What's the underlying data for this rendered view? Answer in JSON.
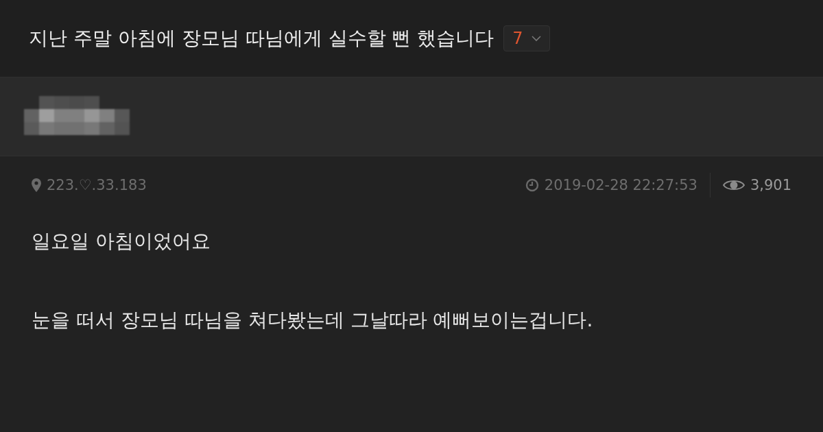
{
  "post": {
    "title": "지난 주말 아침에 장모님 따님에게 실수할 뻔 했습니다",
    "comment_count": "7"
  },
  "author": {
    "kind": "masked"
  },
  "meta": {
    "ip": "223.♡.33.183",
    "date": "2019-02-28 22:27:53",
    "views": "3,901"
  },
  "body": [
    "일요일 아침이었어요",
    "눈을 떠서 장모님 따님을 쳐다봤는데 그날따라 예뻐보이는겁니다."
  ]
}
